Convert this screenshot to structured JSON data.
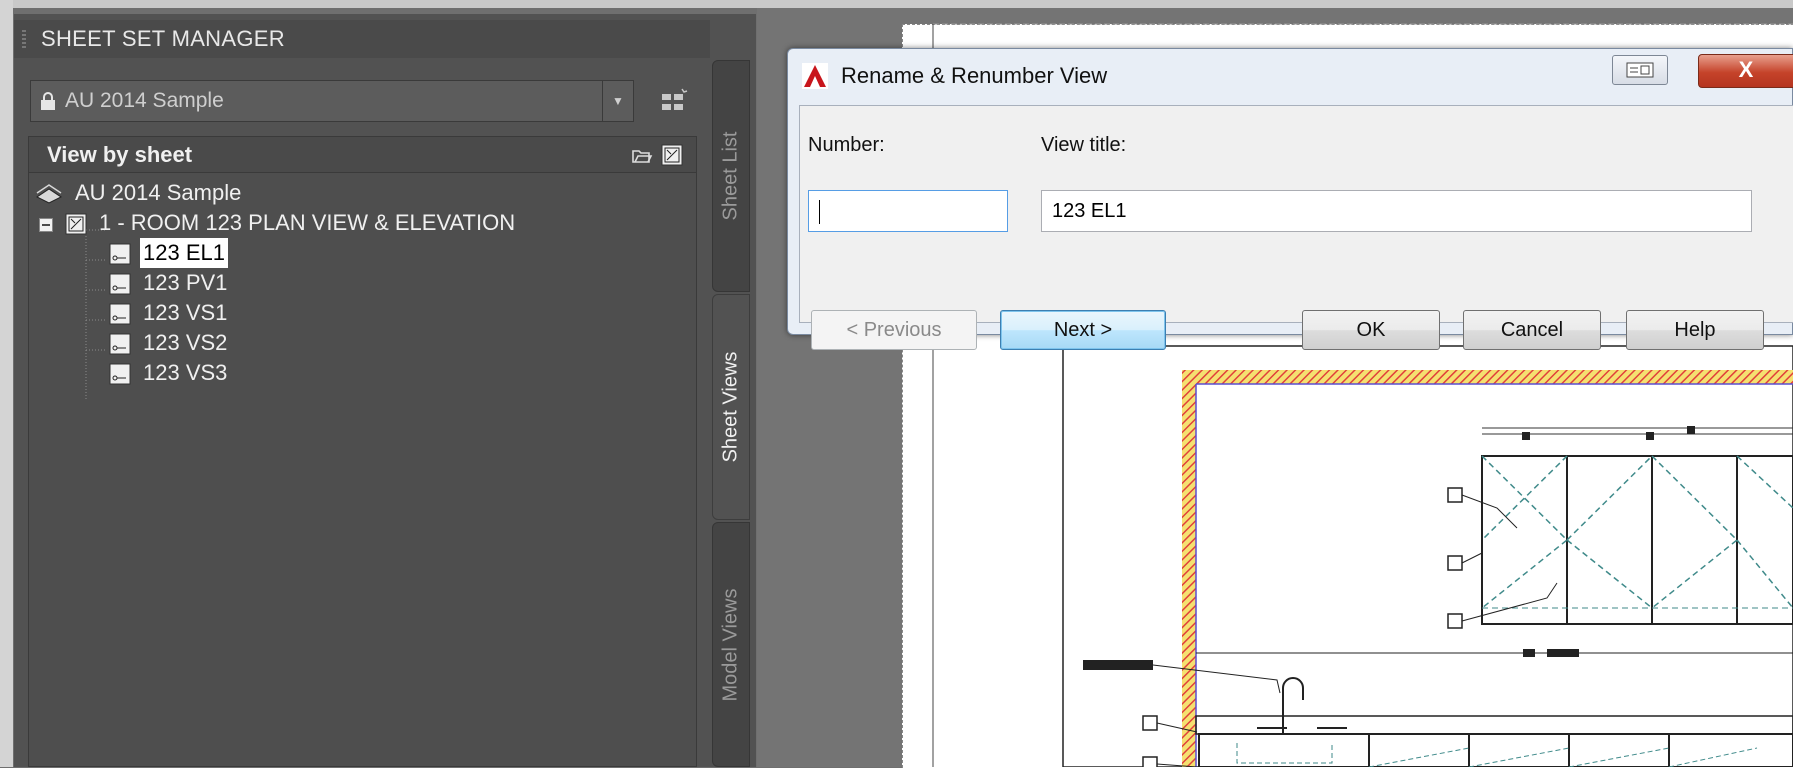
{
  "palette": {
    "title": "SHEET SET MANAGER",
    "sheet_set_selector": {
      "value": "AU 2014 Sample"
    },
    "view_header": "View by sheet",
    "tree": {
      "root": "AU 2014 Sample",
      "sheet": "1 - ROOM 123 PLAN VIEW & ELEVATION",
      "views": [
        "123 EL1",
        "123 PV1",
        "123 VS1",
        "123 VS2",
        "123 VS3"
      ],
      "selected_view": "123 EL1"
    },
    "tabs": [
      {
        "label": "Sheet List",
        "active": false
      },
      {
        "label": "Sheet Views",
        "active": true
      },
      {
        "label": "Model Views",
        "active": false
      }
    ]
  },
  "dialog": {
    "title": "Rename & Renumber View",
    "number_label": "Number:",
    "number_value": "",
    "view_title_label": "View title:",
    "view_title_value": "123 EL1",
    "buttons": {
      "previous": "< Previous",
      "next": "Next >",
      "ok": "OK",
      "cancel": "Cancel",
      "help": "Help"
    },
    "close_glyph": "X"
  },
  "colors": {
    "palette_bg": "#525252",
    "selection_bg": "#ffffff",
    "drawing_hatch": "#e0403a",
    "drawing_border": "#5a4fd0",
    "cabinet_dash": "#3f8a8a",
    "close_button": "#c5432a"
  }
}
